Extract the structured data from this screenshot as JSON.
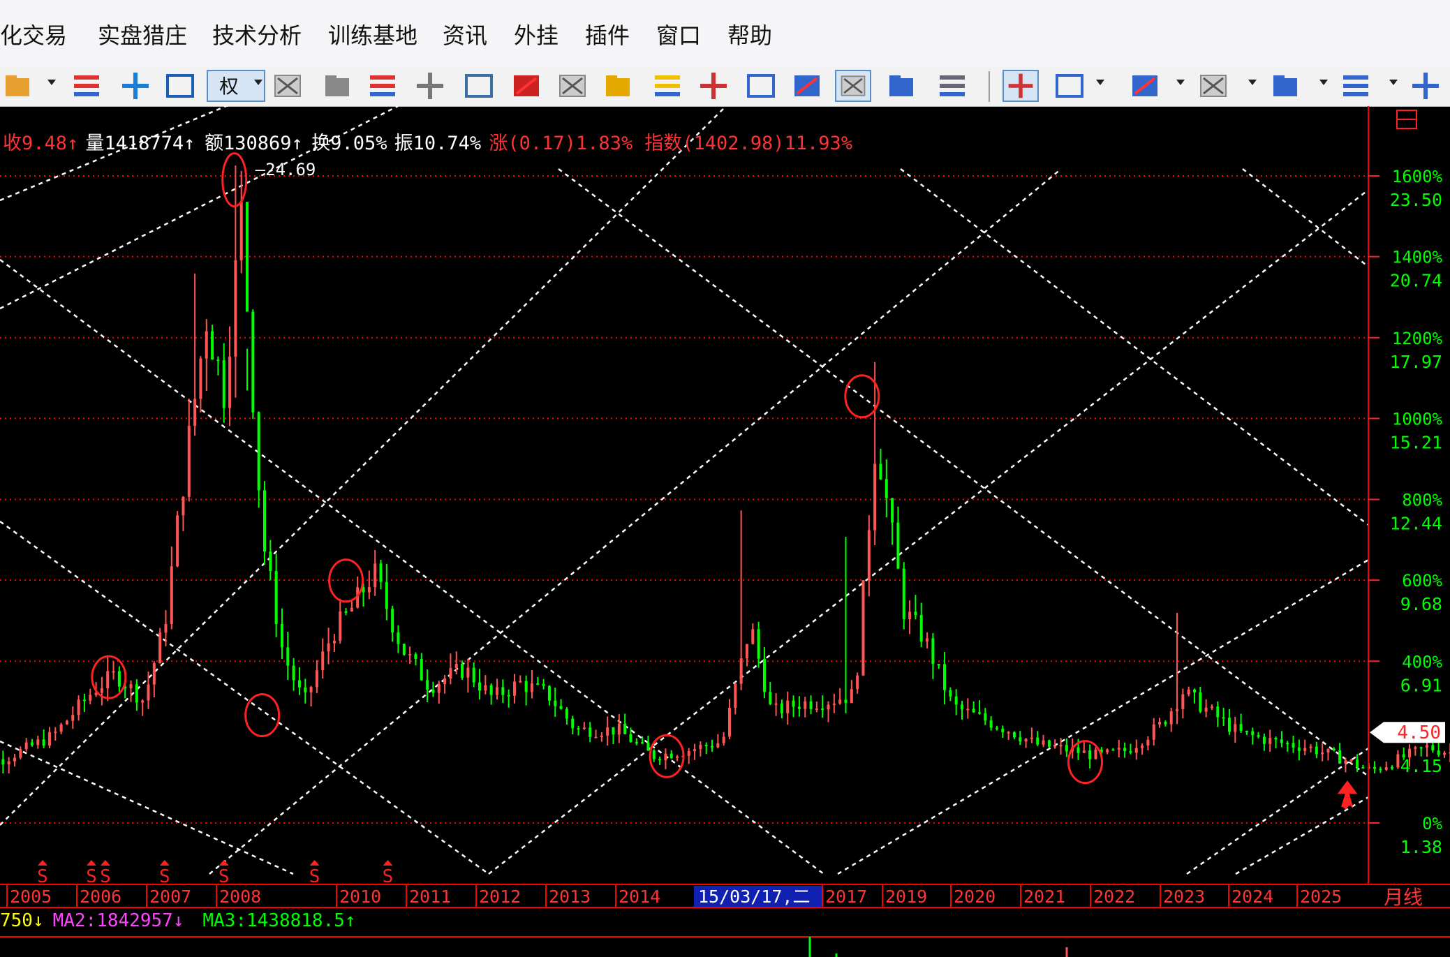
{
  "menu": [
    "化交易",
    "实盘猎庄",
    "技术分析",
    "训练基地",
    "资讯",
    "外挂",
    "插件",
    "窗口",
    "帮助"
  ],
  "toolbar": {
    "quan_label": "权",
    "icons": [
      "open-folder-icon",
      "bar-chart-icon",
      "move-cross-icon",
      "window-layout-icon",
      "quan-button",
      "indicator-green-icon",
      "indicator-x-icon",
      "list-red-icon",
      "copy-icon",
      "f10-icon",
      "alert-chart-icon",
      "money-icon",
      "warning-icon",
      "settings-gear-icon",
      "multi-chart-icon",
      "table-icon",
      "chart-window-1-icon",
      "chart-window-2-icon",
      "chart-window-3-icon",
      "image-icon",
      "draw-pen-icon",
      "draw-line-icon",
      "fib-lines-icon",
      "vertical-lines-icon",
      "fan-lines-icon",
      "gann-icon",
      "parallel-line-icon"
    ]
  },
  "info_bar": [
    {
      "text": "收9.48↑",
      "color": "#ff3333"
    },
    {
      "text": "量1418774↑",
      "color": "#ffffff"
    },
    {
      "text": "额130869↑",
      "color": "#ffffff"
    },
    {
      "text": "换9.05%",
      "color": "#ffffff"
    },
    {
      "text": "振10.74%",
      "color": "#ffffff"
    },
    {
      "text": "涨(0.17)1.83%",
      "color": "#ff3333"
    },
    {
      "text": "指数(1402.98)11.93%",
      "color": "#ff3333"
    }
  ],
  "peak_label": "24.69",
  "current_price_label": "4.50",
  "period_label": "月线",
  "cursor_date": "15/03/17,二",
  "signal_marker": "S",
  "ma_bar": [
    {
      "text": "750↓",
      "color": "#ffff00"
    },
    {
      "text": "MA2:1842957↓",
      "color": "#ff44ff"
    },
    {
      "text": "MA3:1438818.5↑",
      "color": "#00ff00"
    }
  ],
  "colors": {
    "up": "#ff5555",
    "down": "#00ff00",
    "grid": "#ff0000",
    "gann": "#ffffff",
    "axis_text": "#00ff00",
    "menu_bg": "#f5f5f7"
  },
  "chart_data": {
    "type": "candlestick",
    "timeframe": "monthly",
    "right_axis": [
      {
        "pct": "1600%",
        "price": "23.50"
      },
      {
        "pct": "1400%",
        "price": "20.74"
      },
      {
        "pct": "1200%",
        "price": "17.97"
      },
      {
        "pct": "1000%",
        "price": "15.21"
      },
      {
        "pct": "800%",
        "price": "12.44"
      },
      {
        "pct": "600%",
        "price": "9.68"
      },
      {
        "pct": "400%",
        "price": "6.91"
      },
      {
        "pct": "",
        "price": "4.15"
      },
      {
        "pct": "0%",
        "price": "1.38"
      }
    ],
    "years": [
      "2005",
      "2006",
      "2007",
      "2008",
      "2010",
      "2011",
      "2012",
      "2013",
      "2014",
      "2017",
      "2019",
      "2020",
      "2021",
      "2022",
      "2023",
      "2024",
      "2025"
    ],
    "price_anchors": [
      [
        2004.0,
        4.2
      ],
      [
        2004.6,
        4.4
      ],
      [
        2005.3,
        5.2
      ],
      [
        2005.9,
        6.8
      ],
      [
        2006.2,
        7.3
      ],
      [
        2006.6,
        6.4
      ],
      [
        2006.9,
        9.0
      ],
      [
        2007.2,
        14.5
      ],
      [
        2007.5,
        19.5
      ],
      [
        2007.75,
        17.0
      ],
      [
        2008.0,
        23.0
      ],
      [
        2008.3,
        12.0
      ],
      [
        2008.6,
        8.0
      ],
      [
        2008.9,
        6.3
      ],
      [
        2009.3,
        8.7
      ],
      [
        2009.6,
        9.6
      ],
      [
        2009.9,
        10.8
      ],
      [
        2010.3,
        8.2
      ],
      [
        2010.7,
        6.9
      ],
      [
        2011.2,
        7.5
      ],
      [
        2011.6,
        6.5
      ],
      [
        2012.0,
        7.0
      ],
      [
        2012.4,
        6.6
      ],
      [
        2012.8,
        5.4
      ],
      [
        2013.4,
        5.4
      ],
      [
        2013.9,
        4.5
      ],
      [
        2014.4,
        4.7
      ],
      [
        2014.9,
        5.0
      ],
      [
        2015.3,
        9.0
      ],
      [
        2015.6,
        6.0
      ],
      [
        2016.0,
        6.3
      ],
      [
        2016.4,
        6.4
      ],
      [
        2016.8,
        6.6
      ],
      [
        2017.1,
        15.5
      ],
      [
        2017.5,
        9.5
      ],
      [
        2017.8,
        8.5
      ],
      [
        2018.2,
        6.2
      ],
      [
        2018.6,
        5.8
      ],
      [
        2019.0,
        5.4
      ],
      [
        2019.4,
        4.9
      ],
      [
        2019.9,
        4.7
      ],
      [
        2020.3,
        4.5
      ],
      [
        2020.7,
        4.7
      ],
      [
        2021.2,
        5.6
      ],
      [
        2021.5,
        6.7
      ],
      [
        2021.9,
        6.0
      ],
      [
        2022.3,
        5.3
      ],
      [
        2022.8,
        5.0
      ],
      [
        2023.3,
        4.8
      ],
      [
        2023.8,
        4.4
      ],
      [
        2024.2,
        4.0
      ],
      [
        2024.6,
        4.4
      ],
      [
        2025.0,
        4.8
      ],
      [
        2025.4,
        4.6
      ],
      [
        2025.55,
        4.5
      ]
    ],
    "spikes": [
      [
        2007.3,
        21.0
      ],
      [
        2007.9,
        24.69
      ],
      [
        2008.1,
        17.0
      ],
      [
        2015.15,
        12.9
      ],
      [
        2016.7,
        12.0
      ],
      [
        2017.12,
        17.97
      ],
      [
        2017.3,
        12.5
      ],
      [
        2021.4,
        9.4
      ]
    ],
    "highlighted_points": [
      [
        2006.1,
        7.2
      ],
      [
        2008.3,
        5.9
      ],
      [
        2009.5,
        10.5
      ],
      [
        2014.1,
        4.5
      ],
      [
        2016.9,
        16.8
      ],
      [
        2020.1,
        4.3
      ]
    ],
    "signal_years": [
      2005.15,
      2005.85,
      2006.05,
      2006.9,
      2007.75,
      2009.05,
      2010.1
    ]
  }
}
